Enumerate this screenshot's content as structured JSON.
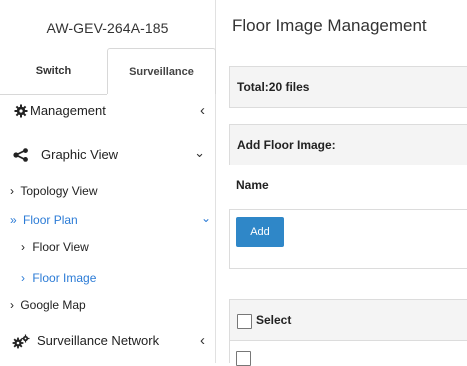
{
  "sidebar": {
    "device_name": "AW-GEV-264A-185",
    "tabs": {
      "switch": "Switch",
      "surveillance": "Surveillance"
    },
    "items": {
      "management": {
        "label": "Management",
        "chevron": "‹"
      },
      "graphic_view": {
        "label": "Graphic View",
        "chevron": "⌄"
      },
      "topology_view": {
        "label": "Topology View",
        "bullet": "›"
      },
      "floor_plan": {
        "label": "Floor Plan",
        "bullet": "»",
        "chevron": "⌄"
      },
      "floor_view": {
        "label": "Floor View",
        "bullet": "›"
      },
      "floor_image": {
        "label": "Floor Image",
        "bullet": "›"
      },
      "google_map": {
        "label": "Google Map",
        "bullet": "›"
      },
      "surveillance_network": {
        "label": "Surveillance Network",
        "chevron": "‹"
      }
    }
  },
  "main": {
    "title": "Floor Image Management",
    "total_label": "Total:20 files",
    "add_section_title": "Add Floor Image:",
    "name_label": "Name",
    "add_button": "Add",
    "select_label": "Select"
  },
  "colors": {
    "accent": "#2b7bd6",
    "button": "#2f87c8"
  },
  "icons": {
    "management": "gear-icon",
    "graphic_view": "share-icon",
    "surveillance_network": "gears-icon"
  }
}
